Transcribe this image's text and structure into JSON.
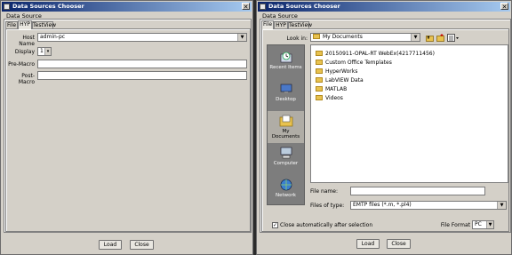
{
  "left_window": {
    "title": "Data Sources Chooser",
    "section_label": "Data Source",
    "tabs": [
      {
        "label": "File",
        "active": false
      },
      {
        "label": "HYP",
        "active": true
      },
      {
        "label": "TestView",
        "active": false
      }
    ],
    "host_name_label": "Host Name",
    "host_name_value": "admin-pc",
    "display_label": "Display",
    "display_value": "1",
    "pre_macro_label": "Pre-Macro",
    "pre_macro_value": "",
    "post_macro_label": "Post-Macro",
    "post_macro_value": "",
    "load_button": "Load",
    "close_button": "Close"
  },
  "right_window": {
    "title": "Data Sources Chooser",
    "section_label": "Data Source",
    "tabs": [
      {
        "label": "File",
        "active": true
      },
      {
        "label": "HYP",
        "active": false
      },
      {
        "label": "TestView",
        "active": false
      }
    ],
    "look_in_label": "Look in:",
    "look_in_value": "My Documents",
    "places": [
      {
        "label": "Recent Items",
        "icon": "recent-items-icon",
        "selected": false
      },
      {
        "label": "Desktop",
        "icon": "desktop-icon",
        "selected": false
      },
      {
        "label": "My Documents",
        "icon": "my-documents-icon",
        "selected": true
      },
      {
        "label": "Computer",
        "icon": "computer-icon",
        "selected": false
      },
      {
        "label": "Network",
        "icon": "network-icon",
        "selected": false
      }
    ],
    "files": [
      "20150911-OPAL-RT WebEx(4217711456)",
      "Custom Office Templates",
      "HyperWorks",
      "LabVIEW Data",
      "MATLAB",
      "Videos"
    ],
    "file_name_label": "File name:",
    "file_name_value": "",
    "files_of_type_label": "Files of type:",
    "files_of_type_value": "EMTP files (*.m, *.pl4)",
    "close_auto_label": "Close automatically after selection",
    "close_auto_checked": true,
    "file_format_label": "File Format",
    "file_format_value": "PC",
    "load_button": "Load",
    "close_button": "Close"
  },
  "colors": {
    "title_start": "#0a246a",
    "title_end": "#a6caf0",
    "window_bg": "#d4d0c8",
    "places_bg": "#7d7d7d",
    "folder": "#e8c24f"
  }
}
